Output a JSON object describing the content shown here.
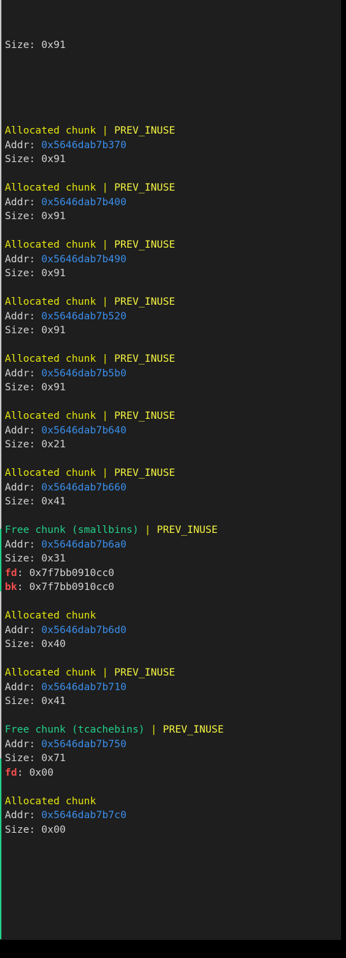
{
  "colors": {
    "background": "#1e1e1e",
    "allocated_title": "#e5e510",
    "free_title": "#23d18b",
    "flag": "#f5f543",
    "address": "#3b8eea",
    "pointer_label": "#f14c4c",
    "text": "#d4d4d4"
  },
  "leading_line": {
    "label": "Size: ",
    "value": "0x91"
  },
  "labels": {
    "separator": " | ",
    "addr": "Addr: ",
    "size": "Size: ",
    "fd": "fd",
    "bk": "bk",
    "colon": ": "
  },
  "chunks": [
    {
      "kind": "allocated",
      "title": "Allocated chunk",
      "flag": "PREV_INUSE",
      "addr": "0x5646dab7b370",
      "size": "0x91"
    },
    {
      "kind": "allocated",
      "title": "Allocated chunk",
      "flag": "PREV_INUSE",
      "addr": "0x5646dab7b400",
      "size": "0x91"
    },
    {
      "kind": "allocated",
      "title": "Allocated chunk",
      "flag": "PREV_INUSE",
      "addr": "0x5646dab7b490",
      "size": "0x91"
    },
    {
      "kind": "allocated",
      "title": "Allocated chunk",
      "flag": "PREV_INUSE",
      "addr": "0x5646dab7b520",
      "size": "0x91"
    },
    {
      "kind": "allocated",
      "title": "Allocated chunk",
      "flag": "PREV_INUSE",
      "addr": "0x5646dab7b5b0",
      "size": "0x91"
    },
    {
      "kind": "allocated",
      "title": "Allocated chunk",
      "flag": "PREV_INUSE",
      "addr": "0x5646dab7b640",
      "size": "0x21"
    },
    {
      "kind": "allocated",
      "title": "Allocated chunk",
      "flag": "PREV_INUSE",
      "addr": "0x5646dab7b660",
      "size": "0x41"
    },
    {
      "kind": "free",
      "title": "Free chunk (smallbins)",
      "flag": "PREV_INUSE",
      "addr": "0x5646dab7b6a0",
      "size": "0x31",
      "fd": "0x7f7bb0910cc0",
      "bk": "0x7f7bb0910cc0"
    },
    {
      "kind": "allocated",
      "title": "Allocated chunk",
      "flag": "",
      "addr": "0x5646dab7b6d0",
      "size": "0x40"
    },
    {
      "kind": "allocated",
      "title": "Allocated chunk",
      "flag": "PREV_INUSE",
      "addr": "0x5646dab7b710",
      "size": "0x41"
    },
    {
      "kind": "free",
      "title": "Free chunk (tcachebins)",
      "flag": "PREV_INUSE",
      "addr": "0x5646dab7b750",
      "size": "0x71",
      "fd": "0x00"
    },
    {
      "kind": "allocated",
      "title": "Allocated chunk",
      "flag": "",
      "addr": "0x5646dab7b7c0",
      "size": "0x00"
    }
  ]
}
